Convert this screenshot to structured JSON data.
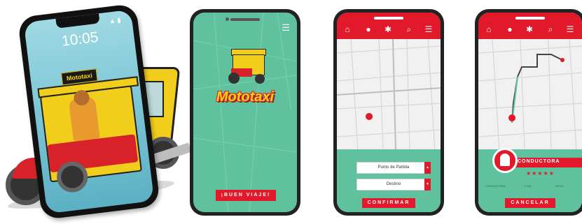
{
  "hero": {
    "time": "10:05",
    "sign": "Mototaxi"
  },
  "splash": {
    "brand": "Mototaxi",
    "cta": "¡BUEN VIAJE!",
    "menu_icon": "hamburger-icon"
  },
  "booking": {
    "nav_icons": [
      "home-icon",
      "pin-icon",
      "gear-icon",
      "search-icon",
      "hamburger-icon"
    ],
    "pickup_placeholder": "Punto de Partida",
    "destination_placeholder": "Destino",
    "confirm": "CONFIRMAR"
  },
  "trip": {
    "nav_icons": [
      "home-icon",
      "pin-icon",
      "gear-icon",
      "search-icon",
      "hamburger-icon"
    ],
    "driver_label": "CONDUCTORA",
    "rating": 5,
    "stats": [
      "CONDUCTORA",
      "1 KM",
      "S/0.00"
    ],
    "cancel": "CANCELAR"
  },
  "colors": {
    "accent": "#e2192b",
    "green": "#5fc19e",
    "yellow": "#f4d418"
  }
}
